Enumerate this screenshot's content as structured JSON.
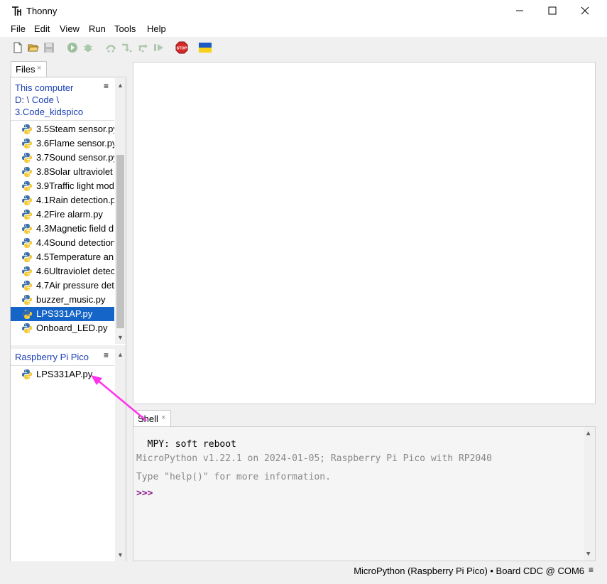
{
  "window": {
    "title": "Thonny"
  },
  "menu": [
    "File",
    "Edit",
    "View",
    "Run",
    "Tools",
    "Help"
  ],
  "toolbar": {
    "icons": [
      "new-file-icon",
      "open-file-icon",
      "save-icon",
      "run-icon",
      "debug-icon",
      "step-over-icon",
      "step-into-icon",
      "step-out-icon",
      "resume-icon",
      "stop-icon",
      "ukraine-flag-icon"
    ],
    "stop_label": "STOP"
  },
  "files": {
    "tab_label": "Files",
    "tab_close": "×",
    "computer": {
      "header": "This computer",
      "path_1": "D: \\ Code \\",
      "path_2": "3.Code_kidspico",
      "menu_glyph": "≡",
      "items": [
        {
          "name": "3.5Steam sensor.py"
        },
        {
          "name": "3.6Flame sensor.py"
        },
        {
          "name": "3.7Sound sensor.py"
        },
        {
          "name": "3.8Solar ultraviolet"
        },
        {
          "name": "3.9Traffic light mod"
        },
        {
          "name": "4.1Rain detection.p"
        },
        {
          "name": "4.2Fire alarm.py"
        },
        {
          "name": "4.3Magnetic field d"
        },
        {
          "name": "4.4Sound detection"
        },
        {
          "name": "4.5Temperature an"
        },
        {
          "name": "4.6Ultraviolet detec"
        },
        {
          "name": "4.7Air pressure det"
        },
        {
          "name": "buzzer_music.py"
        },
        {
          "name": "LPS331AP.py",
          "selected": true
        },
        {
          "name": "Onboard_LED.py"
        }
      ]
    },
    "device": {
      "header": "Raspberry Pi Pico",
      "menu_glyph": "≡",
      "items": [
        {
          "name": "LPS331AP.py"
        }
      ]
    }
  },
  "shell": {
    "tab_label": "Shell",
    "tab_close": "×",
    "lines": [
      {
        "text": "  MPY: soft reboot",
        "color": "#000000"
      },
      {
        "text": "MicroPython v1.22.1 on 2024-01-05; Raspberry Pi Pico with RP2040",
        "color": "#888888"
      },
      {
        "text": "Type \"help()\" for more information.",
        "color": "#888888"
      },
      {
        "text": ">>>",
        "color": "#8b1a8b"
      }
    ]
  },
  "status": {
    "text": "MicroPython (Raspberry Pi Pico)  •  Board CDC @ COM6",
    "menu_glyph": "≡"
  },
  "colors": {
    "selection": "#1565c8",
    "annotation_arrow": "#ff33ee",
    "path_link": "#1a3fb4"
  }
}
